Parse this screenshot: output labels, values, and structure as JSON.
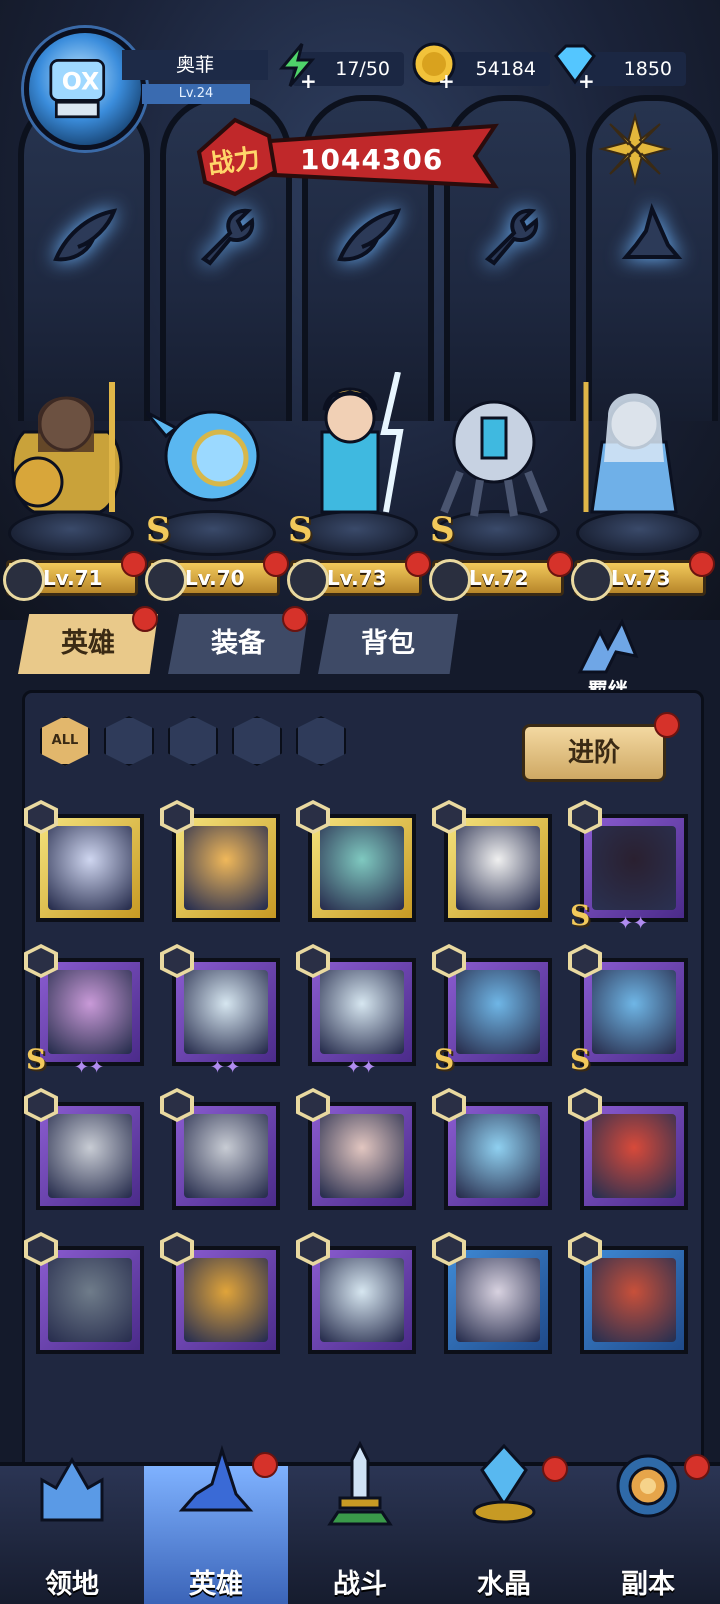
{
  "player": {
    "name": "奥菲",
    "level": "Lv.24"
  },
  "resources": {
    "energy": "17/50",
    "gold": "54184",
    "gems": "1850"
  },
  "power": {
    "label": "战力",
    "value": "1044306"
  },
  "team_heroes": [
    {
      "level": "Lv.71",
      "class": "wing-icon",
      "s_rank": false
    },
    {
      "level": "Lv.70",
      "class": "wrench-icon",
      "s_rank": true
    },
    {
      "level": "Lv.73",
      "class": "wing-icon",
      "s_rank": true
    },
    {
      "level": "Lv.72",
      "class": "wrench-icon",
      "s_rank": true
    },
    {
      "level": "Lv.73",
      "class": "hat-icon",
      "s_rank": false
    }
  ],
  "tabs": {
    "hero": "英雄",
    "equipment": "装备",
    "bag": "背包"
  },
  "bond_label": "羁绊",
  "filters": {
    "all": "ALL"
  },
  "advance_label": "进阶",
  "s_label": "S",
  "nav": {
    "territory": "领地",
    "hero": "英雄",
    "battle": "战斗",
    "crystal": "水晶",
    "dungeon": "副本"
  },
  "colors": {
    "accent_gold": "#f2c95b",
    "notify_red": "#d6322a",
    "rarity_gold": "#e8c84a",
    "rarity_purple": "#7a4cc4",
    "rarity_blue": "#3570c4"
  }
}
